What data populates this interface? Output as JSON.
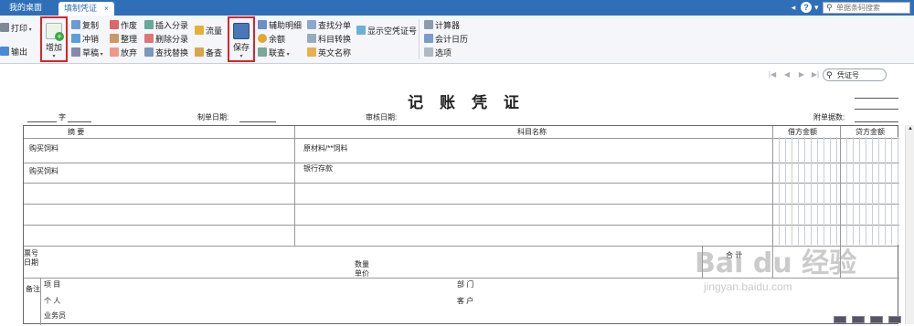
{
  "tabs": [
    {
      "label": "我的桌面",
      "active": false
    },
    {
      "label": "填制凭证",
      "active": true,
      "close": "×"
    }
  ],
  "topbar": {
    "search_placeholder": "单据条码搜索",
    "help": "?",
    "dropdown": "▾",
    "arrow": "◂"
  },
  "ribbon": {
    "print": "打印",
    "export": "输出",
    "add": "增加",
    "copy": "复制",
    "reverse": "冲销",
    "draft": "草稿",
    "void": "作废",
    "tidy": "整理",
    "discard": "放弃",
    "insert_entry": "插入分录",
    "delete_entry": "删除分录",
    "find_replace": "查找替换",
    "flow": "流量",
    "backup": "备查",
    "save": "保存",
    "aux_detail": "辅助明细",
    "balance": "余额",
    "linked_query": "联查",
    "find_entry": "查找分单",
    "subject_convert": "科目转换",
    "english_name": "英文名称",
    "show_empty": "显示空凭证号",
    "calculator": "计算器",
    "accounting_calendar": "会计日历",
    "options": "选项"
  },
  "pager": {
    "first": "|◀",
    "prev": "◀",
    "next": "▶",
    "last": "▶|",
    "voucher_search": "凭证号"
  },
  "voucher": {
    "title": "记 账 凭 证",
    "zi": "字",
    "date_label": "制单日期:",
    "audit_label": "审核日期:",
    "attach_label": "附单据数:",
    "col_summary": "摘 要",
    "col_subject": "科目名称",
    "col_debit": "借方金额",
    "col_credit": "贷方金额",
    "rows": [
      {
        "summary": "购买饲料",
        "subject": "原材料/**饲料"
      },
      {
        "summary": "购买饲料",
        "subject": "银行存款"
      },
      {
        "summary": "",
        "subject": ""
      },
      {
        "summary": "",
        "subject": ""
      },
      {
        "summary": "",
        "subject": ""
      }
    ],
    "ticket_no": "票号",
    "ticket_date": "日期",
    "quantity": "数量",
    "unit": "单价",
    "total": "合 计",
    "remark": "备注",
    "project": "项 目",
    "department": "部 门",
    "individual": "个 人",
    "customer": "客 户",
    "salesman": "业务员"
  },
  "watermark": {
    "brand": "Bai du 经验",
    "url": "jingyan.baidu.com"
  },
  "colors": {
    "tabbar": "#2e6fb8",
    "highlight": "#d9232b",
    "ribbon_bg": "#f4f6f9"
  }
}
